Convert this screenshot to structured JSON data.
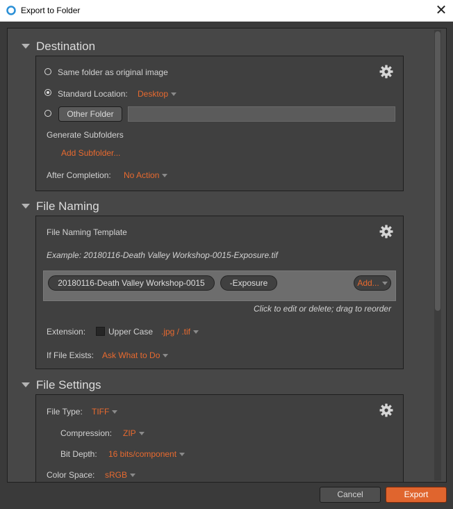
{
  "window": {
    "title": "Export to Folder"
  },
  "destination": {
    "title": "Destination",
    "same_folder_label": "Same folder as original image",
    "standard_location_label": "Standard Location:",
    "standard_location_value": "Desktop",
    "other_folder_button": "Other Folder",
    "other_folder_path": "",
    "generate_subfolders_label": "Generate Subfolders",
    "add_subfolder_link": "Add Subfolder...",
    "after_completion_label": "After Completion:",
    "after_completion_value": "No Action",
    "selected_option": "standard_location"
  },
  "file_naming": {
    "title": "File Naming",
    "template_label": "File Naming Template",
    "example_text": "Example: 20180116-Death Valley Workshop-0015-Exposure.tif",
    "tokens": [
      "20180116-Death Valley Workshop-0015",
      "-Exposure"
    ],
    "add_button": "Add...",
    "hint": "Click to edit or delete; drag to reorder",
    "extension_label": "Extension:",
    "upper_case_label": "Upper Case",
    "upper_case_checked": false,
    "extension_value": ".jpg / .tif",
    "if_exists_label": "If File Exists:",
    "if_exists_value": "Ask What to Do"
  },
  "file_settings": {
    "title": "File Settings",
    "file_type_label": "File Type:",
    "file_type_value": "TIFF",
    "compression_label": "Compression:",
    "compression_value": "ZIP",
    "bit_depth_label": "Bit Depth:",
    "bit_depth_value": "16 bits/component",
    "color_space_label": "Color Space:",
    "color_space_value": "sRGB"
  },
  "footer": {
    "cancel_label": "Cancel",
    "export_label": "Export"
  },
  "colors": {
    "accent": "#e86a2f",
    "panel": "#474747",
    "box": "#404040",
    "export_button": "#e0652e"
  },
  "icons": [
    "app-ring-icon",
    "close-icon",
    "gear-icon",
    "triangle-down-icon",
    "dropdown-arrow-icon"
  ]
}
